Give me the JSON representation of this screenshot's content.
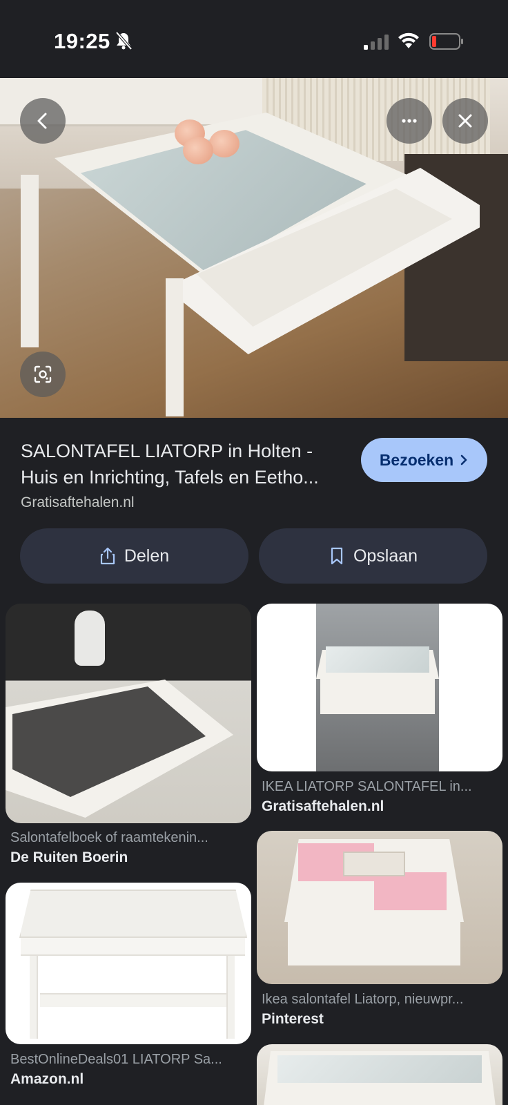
{
  "status_bar": {
    "time": "19:25"
  },
  "result": {
    "title_line1": "SALONTAFEL LIATORP in Holten -",
    "title_line2": "Huis en Inrichting, Tafels en Eetho...",
    "source": "Gratisaftehalen.nl",
    "visit_label": "Bezoeken"
  },
  "actions": {
    "share_label": "Delen",
    "save_label": "Opslaan"
  },
  "related": [
    {
      "title": "Salontafelboek of raamtekenin...",
      "source": "De Ruiten Boerin"
    },
    {
      "title": "IKEA LIATORP SALONTAFEL in...",
      "source": "Gratisaftehalen.nl"
    },
    {
      "title": "Ikea salontafel Liatorp, nieuwpr...",
      "source": "Pinterest"
    },
    {
      "title": "BestOnlineDeals01 LIATORP Sa...",
      "source": "Amazon.nl"
    }
  ],
  "colors": {
    "background": "#1f2024",
    "visit_button": "#a8c7fa",
    "action_button": "#2e3240"
  }
}
